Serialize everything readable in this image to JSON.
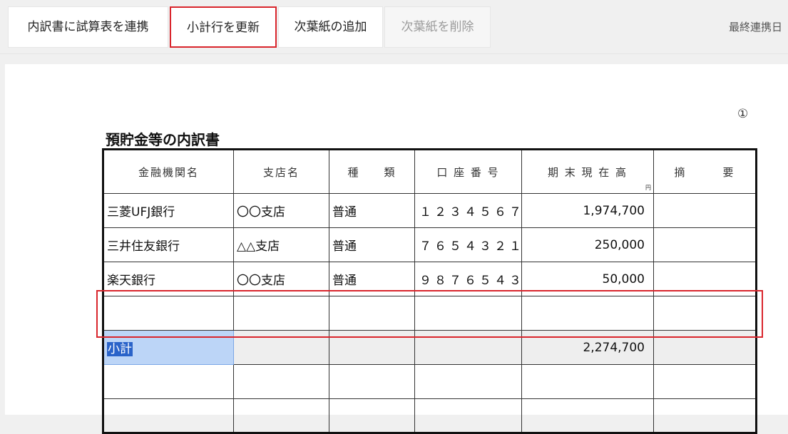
{
  "toolbar": {
    "link_button": "内訳書に試算表を連携",
    "update_subtotal_button": "小計行を更新",
    "add_sheet_button": "次葉紙の追加",
    "delete_sheet_button": "次葉紙を削除",
    "last_sync_label": "最終連携日"
  },
  "document": {
    "page_number": "①",
    "title": "預貯金等の内訳書",
    "headers": {
      "bank": "金融機関名",
      "branch": "支店名",
      "type": "種　　類",
      "account": "口 座 番 号",
      "balance": "期 末 現 在 高",
      "balance_unit": "円",
      "memo": "摘　　　要"
    },
    "rows": [
      {
        "bank": "三菱UFJ銀行",
        "branch": "〇〇支店",
        "type": "普通",
        "account": "１２３４５６７",
        "balance": "1,974,700",
        "memo": ""
      },
      {
        "bank": "三井住友銀行",
        "branch": "△△支店",
        "type": "普通",
        "account": "７６５４３２１",
        "balance": "250,000",
        "memo": ""
      },
      {
        "bank": "楽天銀行",
        "branch": "〇〇支店",
        "type": "普通",
        "account": "９８７６５４３",
        "balance": "50,000",
        "memo": ""
      }
    ],
    "subtotal": {
      "label": "小計",
      "balance": "2,274,700"
    }
  },
  "colors": {
    "highlight": "#d9252c",
    "selection": "#2a63c9"
  }
}
